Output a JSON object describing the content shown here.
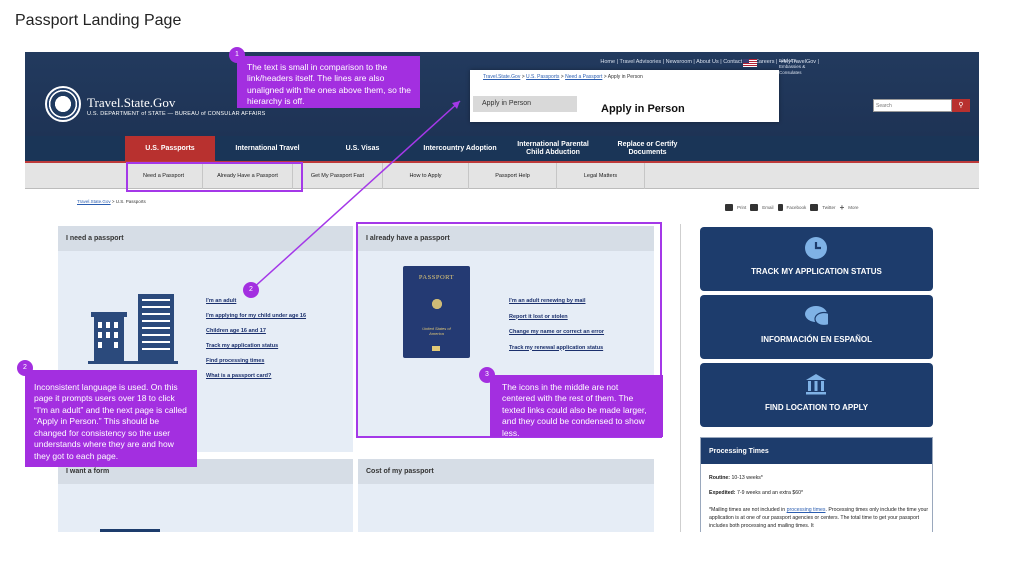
{
  "page_title": "Passport Landing Page",
  "header": {
    "utility_links": "Home | Travel Advisories | Newsroom | About Us | Contact Us | Careers | ➔MyTravelGov |",
    "embassy_text": "Find U.S. Embassies & Consulates",
    "site_name": "Travel.State.Gov",
    "site_sub": "U.S. DEPARTMENT of STATE — BUREAU of CONSULAR AFFAIRS",
    "search_placeholder": "Search",
    "search_icon": "magnifier-icon"
  },
  "main_nav": [
    {
      "label": "U.S. Passports",
      "active": true
    },
    {
      "label": "International Travel"
    },
    {
      "label": "U.S. Visas"
    },
    {
      "label": "Intercountry Adoption"
    },
    {
      "label": "International Parental Child Abduction"
    },
    {
      "label": "Replace or Certify Documents"
    }
  ],
  "sub_nav": [
    "Need a Passport",
    "Already Have a Passport",
    "Get My Passport Fast",
    "How to Apply",
    "Passport Help",
    "Legal Matters"
  ],
  "breadcrumb": {
    "link": "Travel.State.Gov",
    "rest": " > U.S. Passports"
  },
  "share": [
    "Print",
    "Email",
    "Facebook",
    "Twitter",
    "More"
  ],
  "panels": {
    "need": {
      "title": "I need a passport",
      "links": [
        "I'm an adult",
        "I'm applying for my child under age 16",
        "Children age 16 and 17",
        "Track my application status",
        "Find processing times",
        "What is a passport card?"
      ]
    },
    "have": {
      "title": "I already have a passport",
      "links": [
        "I'm an adult renewing by mail",
        "Report it lost or stolen",
        "Change my name or correct an error",
        "Track my renewal application status"
      ],
      "passport_word": "PASSPORT",
      "passport_sub": "United States of America"
    },
    "form": {
      "title": "I want a form"
    },
    "cost": {
      "title": "Cost of my passport"
    }
  },
  "ctas": [
    {
      "label": "TRACK MY APPLICATION STATUS",
      "icon": "clock-icon"
    },
    {
      "label": "INFORMACIÓN EN ESPAÑOL",
      "icon": "chat-bubbles-icon"
    },
    {
      "label": "FIND LOCATION TO APPLY",
      "icon": "building-icon"
    }
  ],
  "processing": {
    "title": "Processing Times",
    "routine_label": "Routine:",
    "routine_value": " 10-13 weeks*",
    "expedited_label": "Expedited:",
    "expedited_value": " 7-9 weeks and an extra $60*",
    "note_pre": "*Mailing times are not included in ",
    "note_link": "processing times",
    "note_post": ". Processing times only include the time your application is at one of our passport agencies or centers. The total time to get your passport includes both processing and mailing times. It"
  },
  "popup": {
    "crumb_links": [
      "Travel.State.Gov",
      "U.S. Passports",
      "Need a Passport"
    ],
    "crumb_rest": "Apply in Person",
    "sep": " > ",
    "side_label": "Apply in Person",
    "title": "Apply in Person"
  },
  "annotations": [
    {
      "number": "1",
      "text": "The text is small in comparison to the link/headers itself. The lines are also unaligned with the ones above them, so the hierarchy is off."
    },
    {
      "number": "2",
      "text": ""
    },
    {
      "number": "2",
      "text": "Inconsistent language is used. On this page it prompts users over 18 to click “I'm an adult” and the next page is called “Apply in Person.” This should be changed for consistency so the user understands where they are and how they got to each page."
    },
    {
      "number": "3",
      "text": "The icons in the middle are not centered with the rest of them. The texted links could also be made larger, and they could be condensed to show less."
    }
  ],
  "colors": {
    "accent_red": "#b8312f",
    "navy": "#1d3c6c",
    "annotation_purple": "#a32fe0"
  }
}
